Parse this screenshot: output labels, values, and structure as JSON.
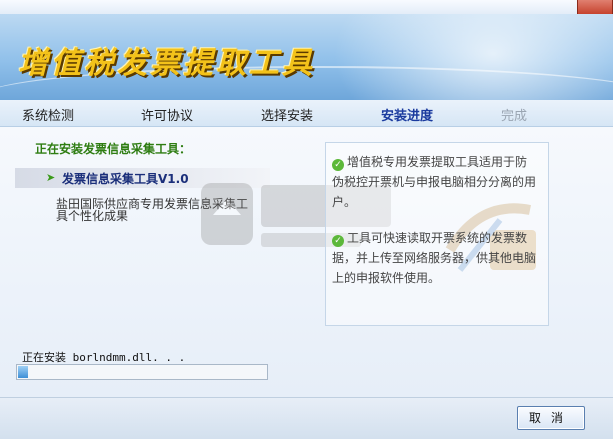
{
  "app": {
    "title": "增值税发票提取工具"
  },
  "steps": [
    {
      "label": "系统检测",
      "state": "done"
    },
    {
      "label": "许可协议",
      "state": "done"
    },
    {
      "label": "选择安装",
      "state": "done"
    },
    {
      "label": "安装进度",
      "state": "current"
    },
    {
      "label": "完成",
      "state": "future"
    }
  ],
  "left": {
    "section_title": "正在安装发票信息采集工具：",
    "item_label": "发票信息采集工具V1.0",
    "item_desc": "盐田国际供应商专用发票信息采集工具个性化成果"
  },
  "info": {
    "items": [
      "增值税专用发票提取工具适用于防伪税控开票机与申报电脑相分分离的用户。",
      "工具可快速读取开票系统的发票数据，并上传至网络服务器，供其他电脑上的申报软件使用。"
    ]
  },
  "status": {
    "text": "正在安装 borlndmm.dll. . .",
    "progress": 0.04
  },
  "footer": {
    "cancel_label": "取消"
  },
  "colors": {
    "title_gold": "#f3c21a",
    "section_green": "#2e7d12",
    "step_current": "#1a3a9e",
    "progress_blue": "#3d8fd6"
  }
}
